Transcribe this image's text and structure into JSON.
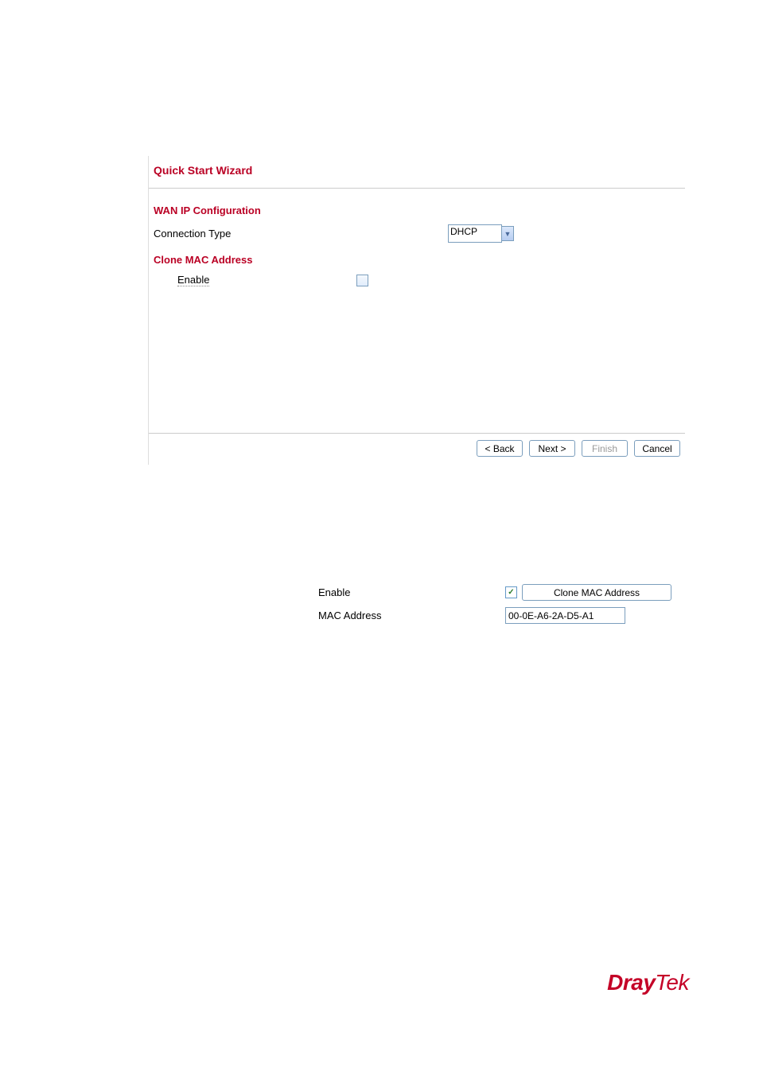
{
  "wizard": {
    "title": "Quick Start Wizard",
    "wan_section": "WAN IP Configuration",
    "conn_type_label": "Connection Type",
    "conn_type_value": "DHCP",
    "clone_mac_section": "Clone MAC Address",
    "enable_label": "Enable",
    "enable_checked": false,
    "buttons": {
      "back": "< Back",
      "next": "Next >",
      "finish": "Finish",
      "cancel": "Cancel"
    }
  },
  "snippet": {
    "enable_label": "Enable",
    "enable_checked": true,
    "clone_button": "Clone MAC Address",
    "mac_label": "MAC Address",
    "mac_value": "00-0E-A6-2A-D5-A1"
  },
  "brand": {
    "bold": "Dray",
    "light": "Tek"
  }
}
